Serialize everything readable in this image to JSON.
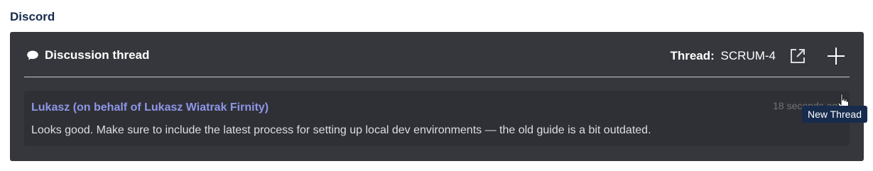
{
  "section": {
    "title": "Discord"
  },
  "panel": {
    "header": {
      "title": "Discussion thread",
      "thread_label": "Thread:",
      "thread_value": "SCRUM-4"
    },
    "actions": {
      "open_external_icon": "open-external-icon",
      "new_thread_icon": "plus-icon",
      "tooltip": "New Thread"
    }
  },
  "message": {
    "author": "Lukasz (on behalf of Lukasz Wiatrak Firnity)",
    "timestamp": "18 seconds ago",
    "text": "Looks good. Make sure to include the latest process for setting up local dev environments — the old guide is a bit outdated."
  },
  "colors": {
    "panel_bg": "#36373d",
    "message_bg": "#2f3035",
    "author": "#8d96e8",
    "tooltip_bg": "#172b4d"
  }
}
